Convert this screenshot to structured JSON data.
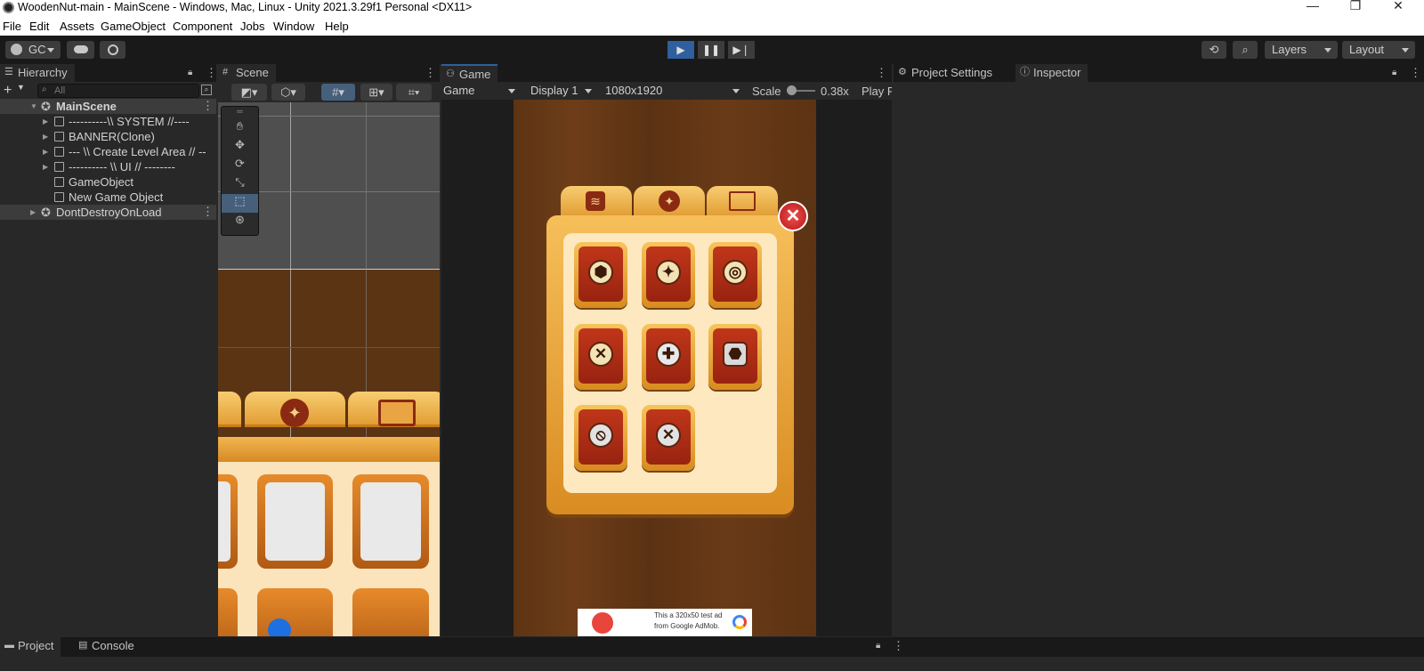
{
  "window": {
    "title": "WoodenNut-main - MainScene - Windows, Mac, Linux - Unity 2021.3.29f1 Personal <DX11>",
    "controls": {
      "minimize": "—",
      "restore": "❐",
      "close": "✕"
    }
  },
  "menu": [
    "File",
    "Edit",
    "Assets",
    "GameObject",
    "Component",
    "Jobs",
    "Window",
    "Help"
  ],
  "toolbar": {
    "account_label": "GC",
    "layers_label": "Layers",
    "layout_label": "Layout"
  },
  "hierarchy": {
    "tab_label": "Hierarchy",
    "search_placeholder": "All",
    "add_label": "+",
    "items": [
      {
        "label": "MainScene",
        "bold": true
      },
      {
        "label": "----------\\\\ SYSTEM //----"
      },
      {
        "label": "BANNER(Clone)"
      },
      {
        "label": "--- \\\\ Create Level Area // --"
      },
      {
        "label": "---------- \\\\ UI // --------"
      },
      {
        "label": "GameObject"
      },
      {
        "label": "New Game Object"
      },
      {
        "label": "DontDestroyOnLoad",
        "bold": false
      }
    ]
  },
  "scene": {
    "tab_label": "Scene"
  },
  "game": {
    "tab_label": "Game",
    "view_mode": "Game",
    "display": "Display 1",
    "resolution": "1080x1920",
    "scale_label": "Scale",
    "scale_value": "0.38x",
    "play_label": "Play F",
    "ad_text_line1": "This a 320x50 test ad",
    "ad_text_line2": "from Google AdMob."
  },
  "right_panel": {
    "tab_project_settings": "Project Settings",
    "tab_inspector": "Inspector"
  },
  "bottom": {
    "tab_project": "Project",
    "tab_console": "Console"
  },
  "colors": {
    "accent_play": "#2f5f9e",
    "wood": "#5d3413",
    "tile_red": "#b3301a",
    "close_red": "#d9252b"
  }
}
